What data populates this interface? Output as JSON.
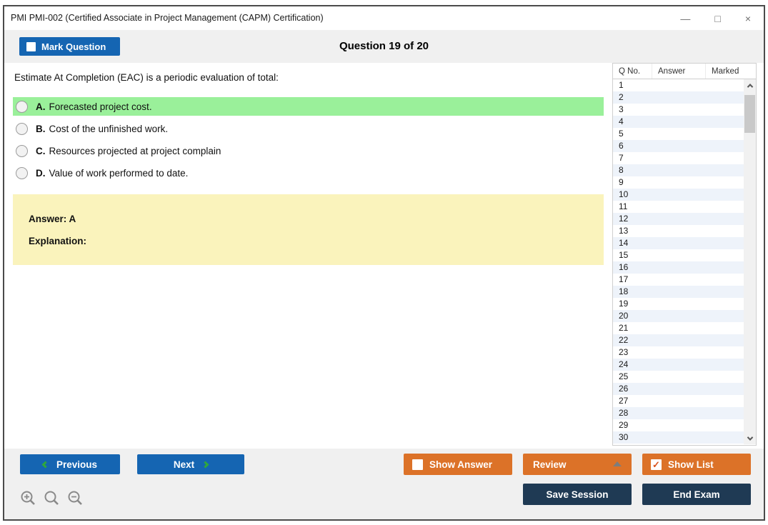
{
  "window": {
    "title": "PMI PMI-002 (Certified Associate in Project Management (CAPM) Certification)",
    "controls": {
      "minimize": "—",
      "maximize": "□",
      "close": "×"
    }
  },
  "header": {
    "mark_question_label": "Mark Question",
    "question_counter": "Question 19 of 20"
  },
  "question": {
    "text": "Estimate At Completion (EAC) is a periodic evaluation of total:",
    "options": [
      {
        "letter": "A.",
        "text": "Forecasted project cost.",
        "highlighted": true
      },
      {
        "letter": "B.",
        "text": "Cost of the unfinished work.",
        "highlighted": false
      },
      {
        "letter": "C.",
        "text": "Resources projected at project complain",
        "highlighted": false
      },
      {
        "letter": "D.",
        "text": "Value of work performed to date.",
        "highlighted": false
      }
    ],
    "answer_label": "Answer: A",
    "explanation_label": "Explanation:"
  },
  "question_list": {
    "columns": {
      "q_no": "Q No.",
      "answer": "Answer",
      "marked": "Marked"
    },
    "rows": [
      "1",
      "2",
      "3",
      "4",
      "5",
      "6",
      "7",
      "8",
      "9",
      "10",
      "11",
      "12",
      "13",
      "14",
      "15",
      "16",
      "17",
      "18",
      "19",
      "20",
      "21",
      "22",
      "23",
      "24",
      "25",
      "26",
      "27",
      "28",
      "29",
      "30"
    ]
  },
  "footer": {
    "previous_label": "Previous",
    "next_label": "Next",
    "show_answer_label": "Show Answer",
    "review_label": "Review",
    "show_list_label": "Show List",
    "save_session_label": "Save Session",
    "end_exam_label": "End Exam"
  },
  "colors": {
    "accent_blue": "#1565b2",
    "accent_orange": "#dc7228",
    "accent_navy": "#1f3a54",
    "highlight_green": "#9af09a",
    "answer_box_yellow": "#faf3bc",
    "alt_row_blue": "#eef3fa",
    "chevron_green": "#2fa83c",
    "strip_gray": "#f0f0f0",
    "check_orange": "#d9531e"
  }
}
